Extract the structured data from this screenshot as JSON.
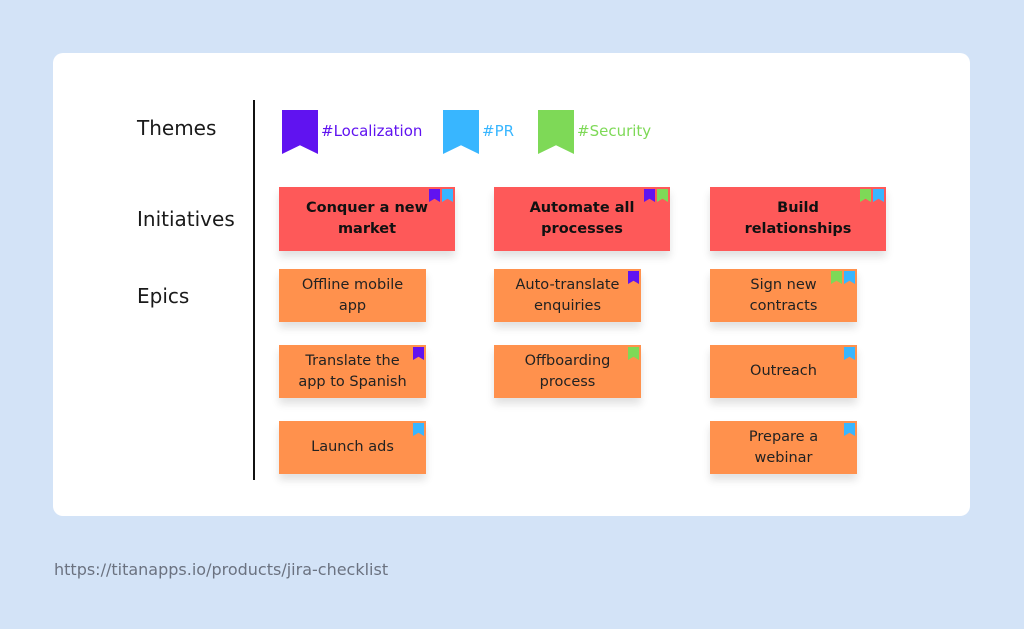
{
  "row_labels": {
    "themes": "Themes",
    "initiatives": "Initiatives",
    "epics": "Epics"
  },
  "colors": {
    "localization": "#6013f0",
    "pr": "#38b6ff",
    "security": "#7ed957",
    "initiative": "#fe5959",
    "epic": "#ff914d"
  },
  "themes": [
    {
      "label": "#Localization",
      "key": "localization"
    },
    {
      "label": "#PR",
      "key": "pr"
    },
    {
      "label": "#Security",
      "key": "security"
    }
  ],
  "initiatives": [
    {
      "label": "Conquer a new market",
      "tags": [
        "localization",
        "pr"
      ]
    },
    {
      "label": "Automate all processes",
      "tags": [
        "localization",
        "security"
      ]
    },
    {
      "label": "Build relationships",
      "tags": [
        "security",
        "pr"
      ]
    }
  ],
  "epics": [
    {
      "label": "Offline mobile app",
      "column": 0,
      "row": 0,
      "tags": []
    },
    {
      "label": "Translate the app to Spanish",
      "column": 0,
      "row": 1,
      "tags": [
        "localization"
      ]
    },
    {
      "label": "Launch ads",
      "column": 0,
      "row": 2,
      "tags": [
        "pr"
      ]
    },
    {
      "label": "Auto-translate enquiries",
      "column": 1,
      "row": 0,
      "tags": [
        "localization"
      ]
    },
    {
      "label": "Offboarding process",
      "column": 1,
      "row": 1,
      "tags": [
        "security"
      ]
    },
    {
      "label": "Sign new contracts",
      "column": 2,
      "row": 0,
      "tags": [
        "security",
        "pr"
      ]
    },
    {
      "label": "Outreach",
      "column": 2,
      "row": 1,
      "tags": [
        "pr"
      ]
    },
    {
      "label": "Prepare a webinar",
      "column": 2,
      "row": 2,
      "tags": [
        "pr"
      ]
    }
  ],
  "footer_url": "https://titanapps.io/products/jira-checklist"
}
